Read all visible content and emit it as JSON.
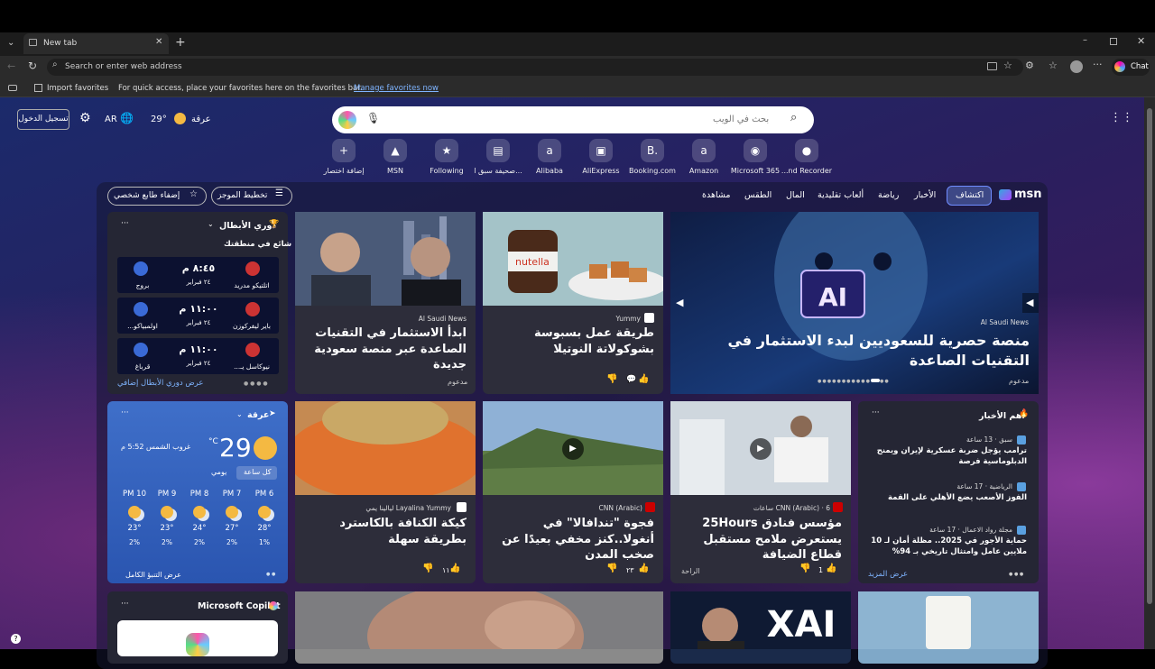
{
  "browser": {
    "tab_title": "New tab",
    "address_placeholder": "Search or enter web address",
    "chat_label": "Chat",
    "import_favorites": "Import favorites",
    "favorites_hint": "For quick access, place your favorites here on the favorites bar.",
    "manage_favorites": "Manage favorites now"
  },
  "top": {
    "signin": "تسجيل الدخول",
    "language": "AR",
    "temperature": "29°",
    "location": "عرقة"
  },
  "search": {
    "placeholder": "بحث في الويب"
  },
  "quicklinks": [
    {
      "label": "إضافة اختصار",
      "icon": "plus-icon"
    },
    {
      "label": "MSN",
      "icon": "msn-icon"
    },
    {
      "label": "Following",
      "icon": "star-icon"
    },
    {
      "label": "صحيفة سبق ا...",
      "icon": "news-icon"
    },
    {
      "label": "Alibaba",
      "icon": "alibaba-icon"
    },
    {
      "label": "AliExpress",
      "icon": "aliexpress-icon"
    },
    {
      "label": "Booking.com",
      "icon": "booking-icon"
    },
    {
      "label": "Amazon",
      "icon": "amazon-icon"
    },
    {
      "label": "Microsoft 365",
      "icon": "m365-icon"
    },
    {
      "label": "...nd Recorder",
      "icon": "recorder-icon"
    }
  ],
  "nav": {
    "brand": "msn",
    "items": [
      "اكتشاف",
      "الأخبار",
      "رياضة",
      "ألعاب تقليدية",
      "المال",
      "الطقس",
      "مشاهدة"
    ],
    "layout": "تخطيط الموجز",
    "personalize": "إضفاء طابع شخصي"
  },
  "sports": {
    "title": "دوري الأبطال",
    "trending": "شائع في منطقتك",
    "more": "عرض دوري الأبطال إضافي",
    "matches": [
      {
        "home": "اتلتيكو مدريد",
        "away": "بروج",
        "time": "٨:٤٥ م",
        "date": "٢٤ فبراير"
      },
      {
        "home": "باير ليفركوزن",
        "away": "اولمبياكو...",
        "time": "١١:٠٠ م",
        "date": "٢٤ فبراير"
      },
      {
        "home": "نيوكاسل يـ...",
        "away": "قرباغ",
        "time": "١١:٠٠ م",
        "date": "٢٤ فبراير"
      }
    ]
  },
  "hero": {
    "title": "منصة حصرية للسعوديين لبدء الاستثمار في التقنيات الصاعدة",
    "source": "Al Saudi News",
    "sponsored": "مدعوم",
    "badge": "AI"
  },
  "card1": {
    "title": "ابدأ الاستثمار في التقنيات الصاعدة عبر منصة سعودية جديدة",
    "source": "Al Saudi News",
    "sponsored": "مدعوم"
  },
  "card2": {
    "title": "طريقة عمل بسبوسة بشوكولاتة النوتيلا",
    "source": "Yummy",
    "jar": "nutella"
  },
  "weather": {
    "location": "عرقة",
    "temp": "29",
    "unit": "°C",
    "sunset": "غروب الشمس 5:52 م",
    "tab_hourly": "كل ساعة",
    "tab_daily": "يومي",
    "full": "عرض التنبؤ الكامل",
    "hours": [
      {
        "t": "PM 6",
        "temp": "28°",
        "rain": "1%"
      },
      {
        "t": "PM 7",
        "temp": "27°",
        "rain": "2%"
      },
      {
        "t": "PM 8",
        "temp": "24°",
        "rain": "2%"
      },
      {
        "t": "PM 9",
        "temp": "23°",
        "rain": "2%"
      },
      {
        "t": "PM 10",
        "temp": "23°",
        "rain": "2%"
      }
    ]
  },
  "card3": {
    "title": "كيكة الكنافة بالكاسترد بطريقة سهلة",
    "source": "Layalina Yummy ليالينا يمي",
    "likes": "١١"
  },
  "card4": {
    "title": "فجوة \"تندافالا\" في أنغولا..كنز مخفي بعيدًا عن صخب المدن",
    "source": "CNN (Arabic)",
    "likes": "٢٣"
  },
  "card5": {
    "title": "مؤسس فنادق 25Hours يستعرض ملامح مستقبل قطاع الضيافة",
    "source": "CNN (Arabic) · 6 ساعات",
    "likes": "1",
    "tag": "الراحة"
  },
  "top_news": {
    "title": "أهم الأخبار",
    "more": "عرض المزيد",
    "items": [
      {
        "source": "سبق · 13 ساعة",
        "text": "ترامب يؤجل ضربة عسكرية لإيران ويمنح الدبلوماسية فرصة"
      },
      {
        "source": "الرياضية · 17 ساعة",
        "text": "الفوز الأصعب يضع الأهلي على القمة"
      },
      {
        "source": "مجلة رواد الاعمال · 17 ساعة",
        "text": "حماية الأجور في 2025.. مظلة أمان لـ 10 ملايين عامل وامتثال تاريخي بـ 94%"
      }
    ]
  },
  "copilot": {
    "title": "Microsoft Copilot"
  },
  "card6": {
    "badge": "XAI"
  }
}
